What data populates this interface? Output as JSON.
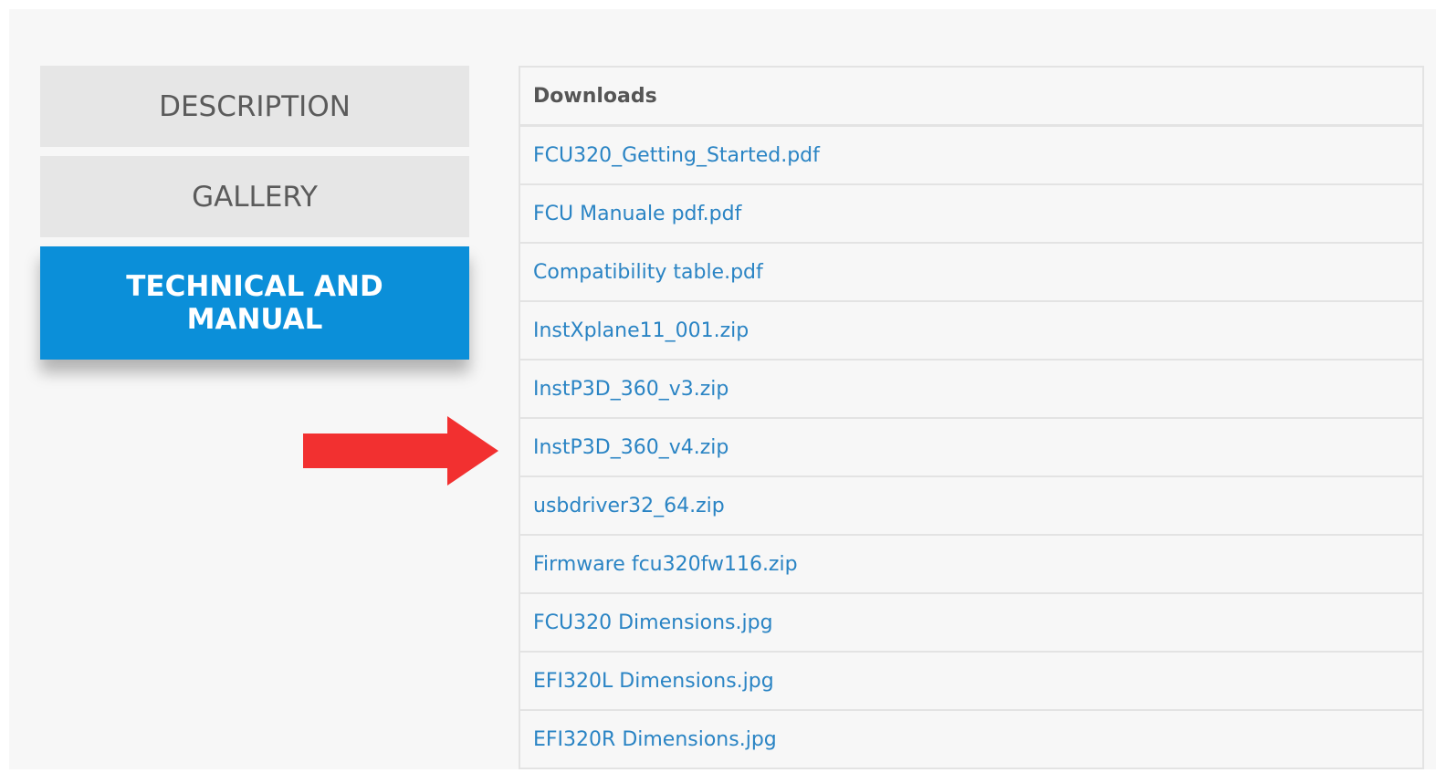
{
  "tabs": [
    {
      "label": "DESCRIPTION"
    },
    {
      "label": "GALLERY"
    },
    {
      "label": "TECHNICAL AND MANUAL"
    }
  ],
  "downloads": {
    "header": "Downloads",
    "files": [
      "FCU320_Getting_Started.pdf",
      "FCU Manuale pdf.pdf",
      "Compatibility table.pdf",
      "InstXplane11_001.zip",
      "InstP3D_360_v3.zip",
      "InstP3D_360_v4.zip",
      "usbdriver32_64.zip",
      "Firmware fcu320fw116.zip",
      "FCU320 Dimensions.jpg",
      "EFI320L Dimensions.jpg",
      "EFI320R Dimensions.jpg"
    ]
  },
  "colors": {
    "active_tab": "#0b8fd9",
    "inactive_tab": "#e6e6e6",
    "link": "#2a84c4",
    "arrow": "#f23030"
  },
  "annotation": {
    "icon": "right-arrow-icon"
  }
}
